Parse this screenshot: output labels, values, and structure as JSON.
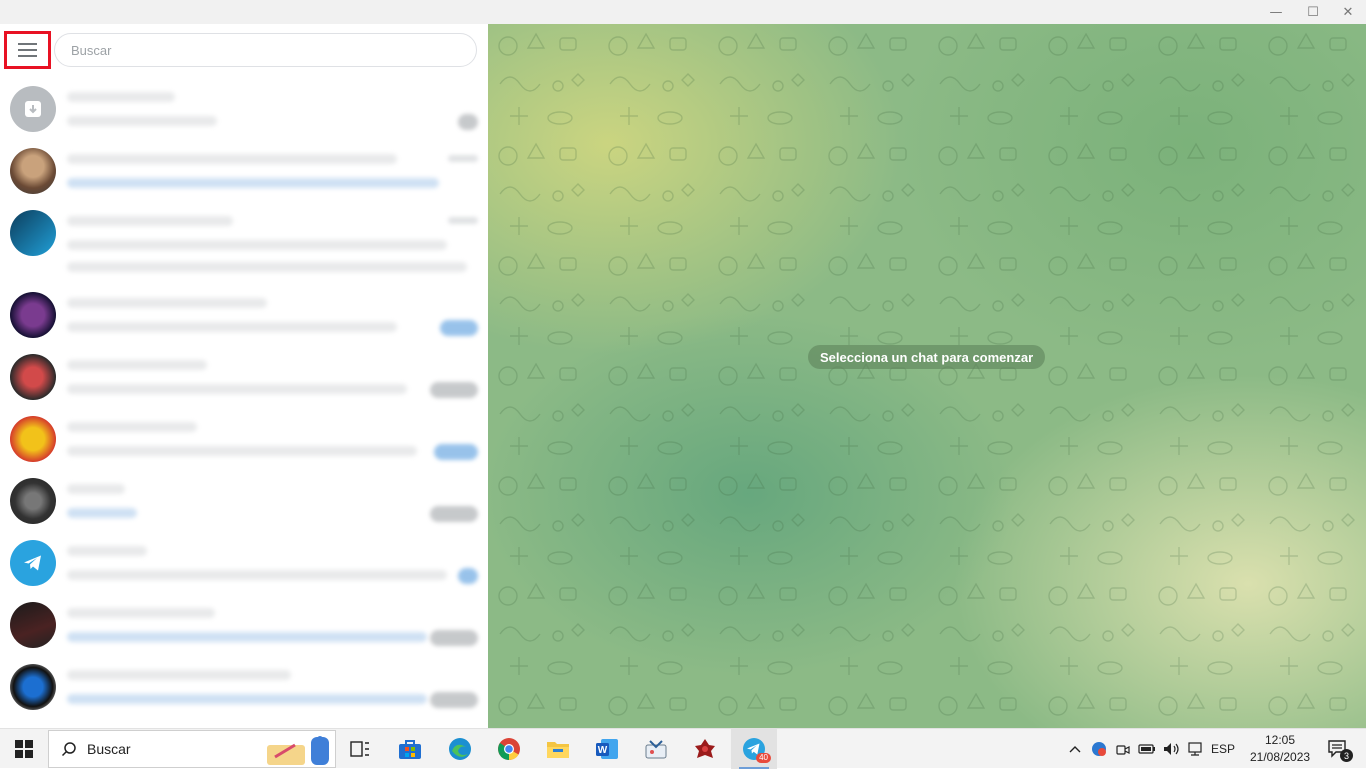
{
  "window": {
    "controls": {
      "minimize": "—",
      "maximize": "☐",
      "close": "✕"
    }
  },
  "sidebar": {
    "menu_icon": "hamburger-menu-icon",
    "search_placeholder": "Buscar"
  },
  "main": {
    "empty_notice": "Selecciona un chat para comenzar"
  },
  "taskbar": {
    "search_label": "Buscar",
    "apps": [
      "task-view-icon",
      "microsoft-store-icon",
      "edge-icon",
      "chrome-icon",
      "file-explorer-icon",
      "word-icon",
      "snipping-app-icon",
      "game-app-icon",
      "telegram-icon"
    ],
    "telegram_badge": "40",
    "tray": {
      "language": "ESP",
      "time": "12:05",
      "date": "21/08/2023",
      "notifications_count": "3"
    }
  },
  "colors": {
    "highlight_border": "#e81123",
    "telegram_blue": "#2aa3df"
  }
}
